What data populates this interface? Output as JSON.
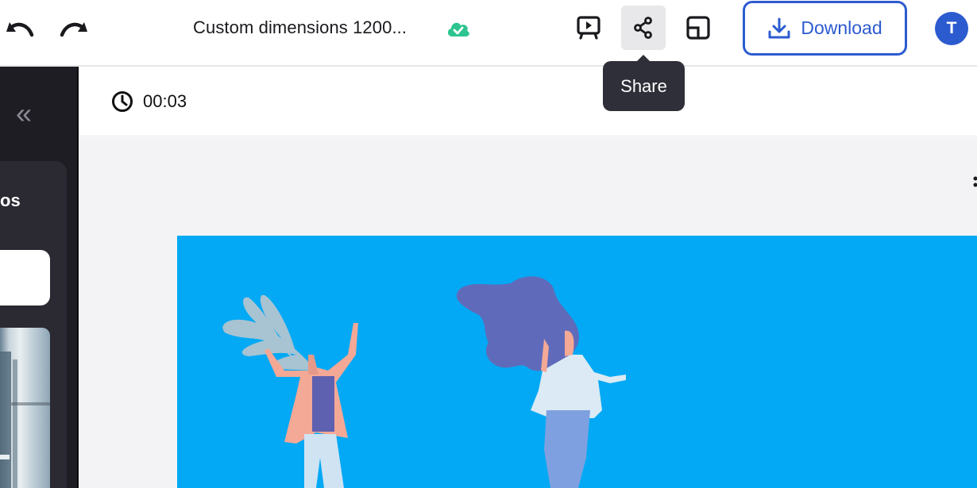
{
  "toolbar": {
    "undo_icon": "undo-icon",
    "redo_icon": "redo-icon",
    "document_title": "Custom dimensions 1200...",
    "save_status_icon": "cloud-check-icon",
    "present_icon": "present-icon",
    "share_icon": "share-icon",
    "resize_icon": "resize-icon",
    "download_label": "Download",
    "download_icon": "download-icon",
    "avatar_initial": "T"
  },
  "tooltip": {
    "label": "Share"
  },
  "sidebar": {
    "collapse_glyph": "«",
    "panel_title": "os"
  },
  "timeline": {
    "duration": "00:03"
  },
  "colors": {
    "accent": "#2c5bd0",
    "saved": "#2ec48f",
    "slide_background": "#03a9f4",
    "sidebar": "#1e1d24"
  }
}
